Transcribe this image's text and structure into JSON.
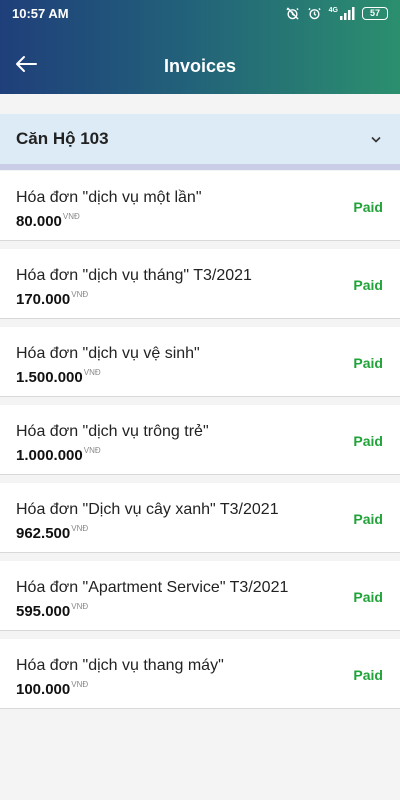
{
  "status_bar": {
    "time": "10:57 AM",
    "network": "4G",
    "battery": "57"
  },
  "app_bar": {
    "title": "Invoices"
  },
  "apartment_selector": {
    "selected": "Căn Hộ 103"
  },
  "invoices": [
    {
      "title": "Hóa đơn \"dịch vụ một lần\"",
      "amount": "80.000",
      "currency": "VNĐ",
      "status": "Paid"
    },
    {
      "title": "Hóa đơn \"dịch vụ tháng\" T3/2021",
      "amount": "170.000",
      "currency": "VNĐ",
      "status": "Paid"
    },
    {
      "title": "Hóa đơn \"dịch vụ vệ sinh\"",
      "amount": "1.500.000",
      "currency": "VNĐ",
      "status": "Paid"
    },
    {
      "title": "Hóa đơn \"dịch vụ trông trẻ\"",
      "amount": "1.000.000",
      "currency": "VNĐ",
      "status": "Paid"
    },
    {
      "title": "Hóa đơn \"Dịch vụ cây xanh\" T3/2021",
      "amount": "962.500",
      "currency": "VNĐ",
      "status": "Paid"
    },
    {
      "title": "Hóa đơn \"Apartment Service\" T3/2021",
      "amount": "595.000",
      "currency": "VNĐ",
      "status": "Paid"
    },
    {
      "title": "Hóa đơn \"dịch vụ thang máy\"",
      "amount": "100.000",
      "currency": "VNĐ",
      "status": "Paid"
    }
  ],
  "colors": {
    "paid_status": "#22a33a",
    "header_gradient_start": "#1f3f7a",
    "header_gradient_end": "#2b8f6e",
    "selector_background": "#dcebf5"
  },
  "icons": {
    "back": "arrow-left-icon",
    "selector": "chevron-down-icon",
    "status": [
      "alarm-off-icon",
      "alarm-clock-icon",
      "signal-icon",
      "battery-icon"
    ]
  }
}
